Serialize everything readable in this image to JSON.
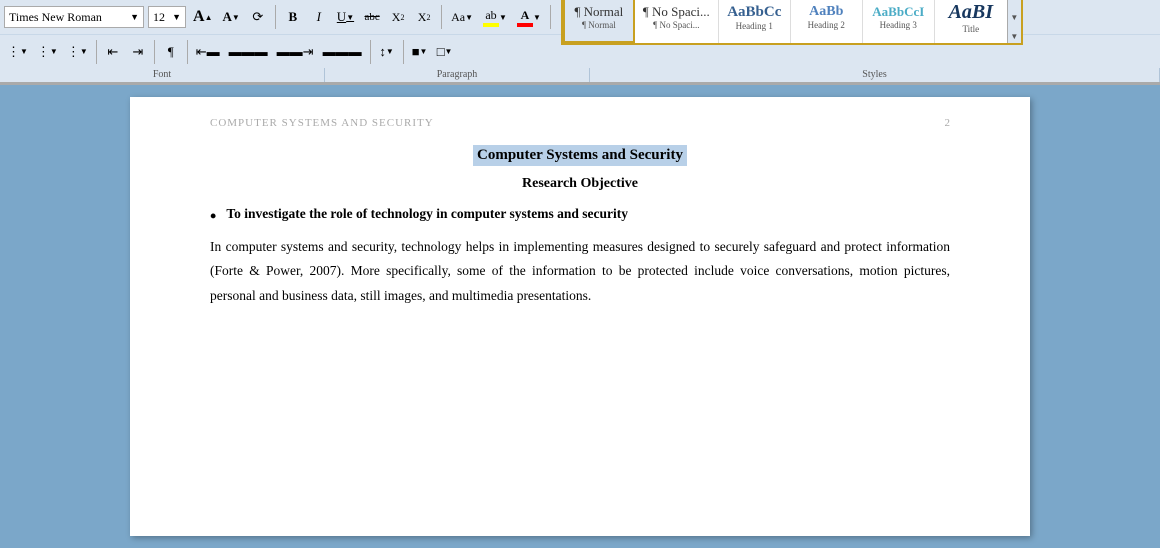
{
  "toolbar": {
    "font_name": "Times New Roman",
    "font_size": "12",
    "grow_label": "A",
    "shrink_label": "A",
    "clear_format_label": "¶",
    "bold_label": "B",
    "italic_label": "I",
    "underline_label": "U",
    "strike_label": "abc",
    "subscript_label": "X₂",
    "superscript_label": "X²",
    "change_case_label": "Aa",
    "highlight_label": "ab",
    "font_color_label": "A"
  },
  "paragraph": {
    "bullets_label": "≡",
    "numbering_label": "≡",
    "multilevel_label": "≡",
    "decrease_indent_label": "←",
    "increase_indent_label": "→",
    "show_para_label": "¶",
    "align_left": "≡",
    "align_center": "≡",
    "align_right": "≡",
    "justify": "≡",
    "line_spacing_label": "↕",
    "shading_label": "▓",
    "borders_label": "□"
  },
  "styles": {
    "items": [
      {
        "id": "normal",
        "preview": "¶ Normal",
        "label": "¶ Normal",
        "active": true
      },
      {
        "id": "no-spacing",
        "preview": "¶ No Spaci...",
        "label": "¶ No Spaci..."
      },
      {
        "id": "heading1",
        "preview": "AaBbCc",
        "label": "Heading 1"
      },
      {
        "id": "heading2",
        "preview": "AaBb",
        "label": "Heading 2"
      },
      {
        "id": "heading3",
        "preview": "AaBbCcI",
        "label": "Heading 3"
      },
      {
        "id": "title",
        "preview": "AaBI",
        "label": "Title"
      }
    ]
  },
  "sections": {
    "font_label": "Font",
    "paragraph_label": "Paragraph",
    "styles_label": "Styles"
  },
  "document": {
    "header_title": "COMPUTER SYSTEMS AND SECURITY",
    "page_number": "2",
    "title": "Computer Systems and Security",
    "subtitle": "Research Objective",
    "bullet_text": "To investigate the role of technology in computer systems and security",
    "body_text": "In computer systems and security, technology helps in implementing measures designed to securely safeguard and protect information (Forte & Power, 2007). More specifically, some of the information to be protected include voice conversations, motion pictures, personal and business data, still images, and multimedia presentations."
  }
}
